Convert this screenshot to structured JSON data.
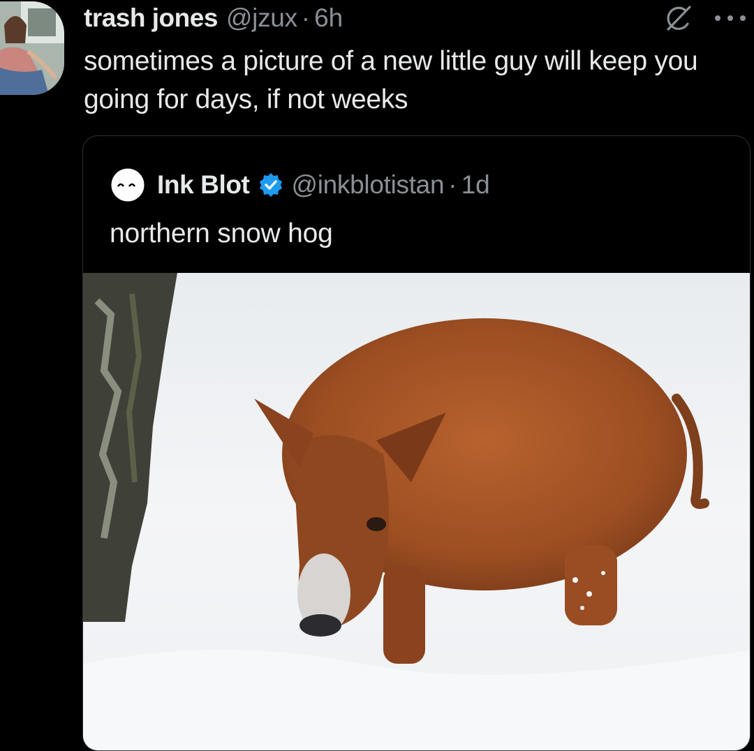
{
  "tweet": {
    "author_name": "trash jones",
    "author_handle": "@jzux",
    "separator": "·",
    "time": "6h",
    "text": "sometimes a picture of a new little guy will keep you going for days, if not weeks",
    "avatar_icon": "profile-photo",
    "actions": {
      "grok_icon": "grok-icon",
      "more_icon": "more-options-icon"
    }
  },
  "quoted_tweet": {
    "author_name": "Ink Blot",
    "author_handle": "@inkblotistan",
    "separator": "·",
    "time": "1d",
    "text": "northern snow hog",
    "verified": true,
    "verified_color": "#1d9bf0",
    "media": {
      "type": "photo",
      "subject": "pig-in-snow-photo"
    }
  },
  "colors": {
    "background": "#000000",
    "primary_text": "#e7e9ea",
    "secondary_text": "#8b9096",
    "border": "#2f3336"
  }
}
